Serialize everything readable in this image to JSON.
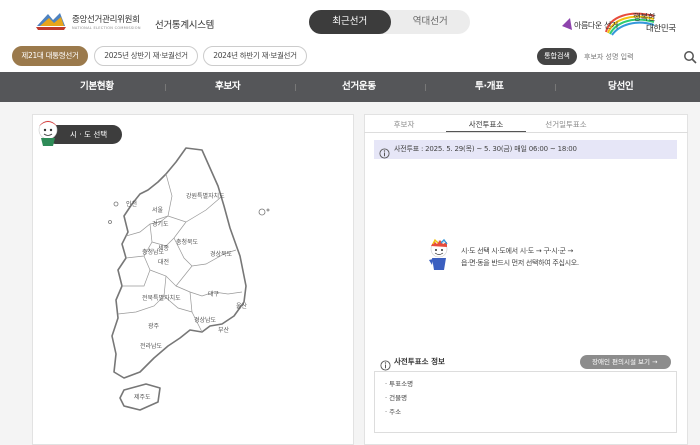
{
  "header": {
    "org_name": "중앙선거관리위원회",
    "org_name_en": "NATIONAL ELECTION COMMISSION",
    "system_name": "선거통계시스템",
    "tabs": [
      {
        "label": "최근선거",
        "active": true
      },
      {
        "label": "역대선거",
        "active": false
      }
    ],
    "slogan": {
      "line_a": "아름다운 선거",
      "line_b": "행복한",
      "line_c": "대한민국"
    }
  },
  "subbar": {
    "chips": [
      {
        "label": "제21대 대통령선거",
        "active": true
      },
      {
        "label": "2025년 상반기 재·보궐선거",
        "active": false
      },
      {
        "label": "2024년 하반기 재·보궐선거",
        "active": false
      }
    ],
    "search_badge": "통합검색",
    "search_placeholder": "후보자 성명 입력"
  },
  "nav": {
    "items": [
      "기본현황",
      "후보자",
      "선거운동",
      "투·개표",
      "당선인"
    ]
  },
  "left": {
    "sido_label": "시 · 도 선택",
    "regions": [
      "인천",
      "서울",
      "경기도",
      "강원특별자치도",
      "충청남도",
      "세종",
      "충청북도",
      "대전",
      "경상북도",
      "전북특별자치도",
      "대구",
      "울산",
      "광주",
      "경상남도",
      "부산",
      "전라남도",
      "제주도"
    ]
  },
  "right": {
    "tabs": [
      {
        "label": "후보자",
        "active": false
      },
      {
        "label": "사전투표소",
        "active": true
      },
      {
        "label": "선거일투표소",
        "active": false
      }
    ],
    "period": "사전투표 : 2025. 5. 29(목) ~ 5. 30(금) 매일 06:00 ~ 18:00",
    "notice_line1": "시·도 선택 시·도에서 시·도 → 구·시·군 →",
    "notice_line2": "읍·면·동을 반드시 먼저 선택하여 주십시오.",
    "info_title": "사전투표소 정보",
    "info_button": "장애인 편의시설 보기 →",
    "info_items": [
      "투표소명",
      "건물명",
      "주소"
    ]
  },
  "colors": {
    "nav_bg": "#555659",
    "chip_active": "#9b7a4c",
    "info_bar": "#e6e6f7",
    "tab_active": "#3c3c3c"
  }
}
